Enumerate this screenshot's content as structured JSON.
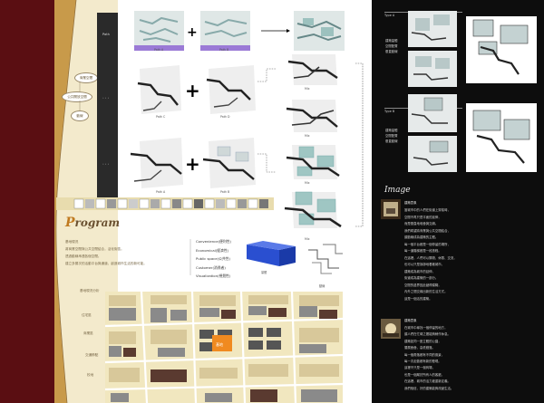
{
  "panel_top": {
    "vertical_label": "Path",
    "row_labels": [
      "Path A",
      "Path B",
      "Path C",
      "Path D"
    ],
    "merge_label": "Mix"
  },
  "program": {
    "title_initial": "P",
    "title_rest": "rogram",
    "nodes": [
      "商業空間",
      "公共開放空間",
      "動線"
    ],
    "intro_lines": [
      "基地現況",
      "將商業空間與公共空間結合，活化街區。",
      "透過動線串連各個空間。",
      "建立多層次的活動平台與通道，創造城市生活的新可能。"
    ],
    "legend": [
      "Convenience(便利性)",
      "Economical(經濟性)",
      "Public space(公共性)",
      "Customer(消費者)",
      "Visualization(視覺性)"
    ],
    "map_caption": "基地現況分析",
    "site_tag": "基地",
    "map_notes": [
      "住宅區",
      "商業區",
      "交通節點",
      "校地"
    ],
    "sample_caption_1": "量體",
    "sample_caption_2": "動線"
  },
  "right_panel": {
    "type_a": "Type A",
    "type_b": "Type B",
    "type_a_note": [
      "建築量體",
      "空間配置",
      "垂直動線"
    ],
    "type_b_note": [
      "建築量體",
      "空間配置",
      "垂直動線"
    ],
    "image_title": "Image",
    "image_subtitle": "建築意象",
    "image_lines_1": [
      "當城市中的人們在街道上穿梭時，",
      "空間不再只是平面的延伸，",
      "而是垂直地堆疊與交織。",
      "我們希望將商業與公共空間結合，",
      "讓動線成為建築的主體。",
      "每一個平台都是一個停留的場所，",
      "每一道階梯都是一段旅程。",
      "在這裡，人們可以購物、休憩、交流，",
      "也可以只是靜靜地看著城市。",
      "建築成為城市的延伸，",
      "街道成為建築的一部分。",
      "空間的邊界因此變得模糊，",
      "內外之間交織出新的生活方式。",
      "這是一個活的建築。"
    ],
    "image_subtitle_2": "建築意象",
    "image_lines_2": [
      "在城市中尋找一個停留的地方，",
      "讓人們在忙碌之間能夠稍作休息。",
      "建築如同一座立體的公園，",
      "層層疊疊，高低錯落。",
      "每一個角落都有不同的風景，",
      "每一次走動都有新的發現。",
      "這裡不只是一個商場，",
      "也是一個屬於所有人的客廳。",
      "在這裡，城市的活力被重新定義。",
      "我們相信，好的建築能夠改變生活。"
    ]
  },
  "colors": {
    "maroon": "#5a0e12",
    "tan": "#c89a4a",
    "cream": "#f3eacc",
    "dark": "#0d0d0d",
    "purple": "#9a7ad6",
    "teal": "#7fb0ad",
    "blue": "#2a4fd0",
    "orange": "#f08a20"
  }
}
